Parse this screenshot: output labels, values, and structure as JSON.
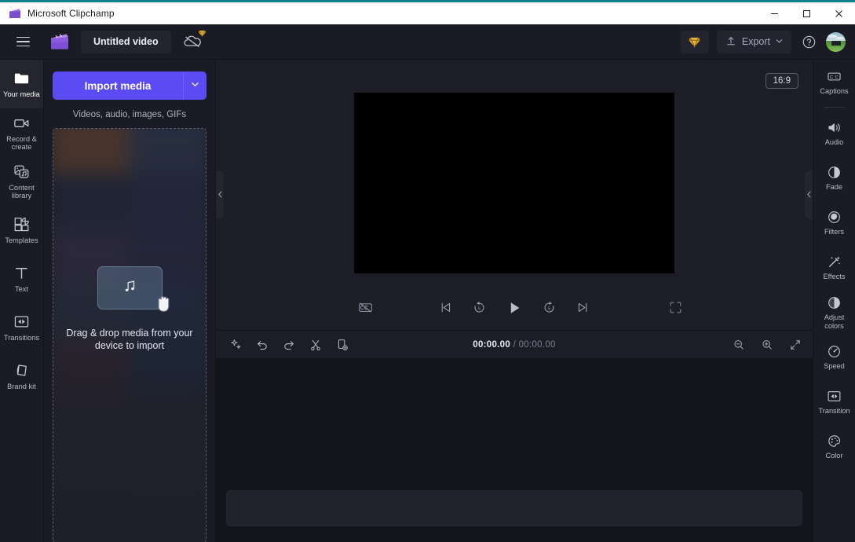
{
  "window": {
    "title": "Microsoft Clipchamp",
    "app_icon": "clapperboard-icon",
    "controls": {
      "minimize": "minimize-icon",
      "maximize": "maximize-icon",
      "close": "close-icon"
    },
    "accent_top": "#10808a"
  },
  "topbar": {
    "menu_icon": "hamburger-menu-icon",
    "brand_icon": "clipchamp-logo-icon",
    "project_name": "Untitled video",
    "sync_icon": "cloud-off-icon",
    "sync_badge_icon": "premium-diamond-icon",
    "premium_icon": "premium-diamond-icon",
    "export_label": "Export",
    "export_icon": "upload-arrow-icon",
    "export_caret_icon": "chevron-down-icon",
    "help_icon": "help-circle-icon",
    "avatar": "user-avatar",
    "accent_color": "#5b4bf2",
    "premium_color": "#e8b339"
  },
  "left_rail": {
    "items": [
      {
        "label": "Your media",
        "icon": "folder-icon",
        "active": true
      },
      {
        "label": "Record & create",
        "icon": "video-camera-icon",
        "active": false
      },
      {
        "label": "Content library",
        "icon": "content-library-icon",
        "active": false
      },
      {
        "label": "Templates",
        "icon": "templates-grid-icon",
        "active": false
      },
      {
        "label": "Text",
        "icon": "text-t-icon",
        "active": false
      },
      {
        "label": "Transitions",
        "icon": "transitions-icon",
        "active": false
      },
      {
        "label": "Brand kit",
        "icon": "brand-kit-icon",
        "active": false
      }
    ]
  },
  "media_panel": {
    "import_label": "Import media",
    "import_caret_icon": "chevron-down-icon",
    "import_subtitle": "Videos, audio, images, GIFs",
    "dropzone": {
      "illustration_card_icon": "music-note-icon",
      "cursor_icon": "drag-hand-icon",
      "text": "Drag & drop media from your device to import"
    },
    "thumbnail_colors": [
      "#6b4630",
      "#2f3b52",
      "#222a3f",
      "#25304a",
      "#3a3350",
      "#2b2f4e",
      "#2c3b4e",
      "#243a56",
      "#4b2f3a",
      "#1f3c5c",
      "#3b3150",
      "#2a2c44",
      "#27303f",
      "#2d3345"
    ]
  },
  "preview": {
    "aspect_ratio": "16:9",
    "canvas_color": "#000000",
    "left_handle_icon": "chevron-left-icon",
    "right_handle_icon": "chevron-left-icon",
    "controls": {
      "captions_icon": "captions-off-icon",
      "skip_start_icon": "skip-to-start-icon",
      "back_five_icon": "rewind-5s-icon",
      "play_icon": "play-icon",
      "forward_five_icon": "forward-5s-icon",
      "skip_end_icon": "skip-to-end-icon",
      "fullscreen_icon": "fullscreen-icon"
    }
  },
  "timeline": {
    "toolbar_icons": [
      "ai-sparkle-icon",
      "undo-icon",
      "redo-icon",
      "split-scissors-icon",
      "duplicate-add-icon"
    ],
    "current_time": "00:00.00",
    "separator": "/",
    "total_time": "00:00.00",
    "zoom_out_icon": "zoom-out-icon",
    "zoom_in_icon": "zoom-in-icon",
    "fit_icon": "fit-to-screen-icon"
  },
  "right_rail": {
    "items": [
      {
        "label": "Captions",
        "icon": "closed-captions-icon",
        "divider_after": true
      },
      {
        "label": "Audio",
        "icon": "speaker-icon",
        "divider_after": false
      },
      {
        "label": "Fade",
        "icon": "fade-icon",
        "divider_after": false
      },
      {
        "label": "Filters",
        "icon": "filters-icon",
        "divider_after": false
      },
      {
        "label": "Effects",
        "icon": "effects-wand-icon",
        "divider_after": false
      },
      {
        "label": "Adjust colors",
        "icon": "adjust-colors-icon",
        "divider_after": false
      },
      {
        "label": "Speed",
        "icon": "speedometer-icon",
        "divider_after": false
      },
      {
        "label": "Transition",
        "icon": "transition-icon",
        "divider_after": false
      },
      {
        "label": "Color",
        "icon": "color-palette-icon",
        "divider_after": false
      }
    ]
  }
}
